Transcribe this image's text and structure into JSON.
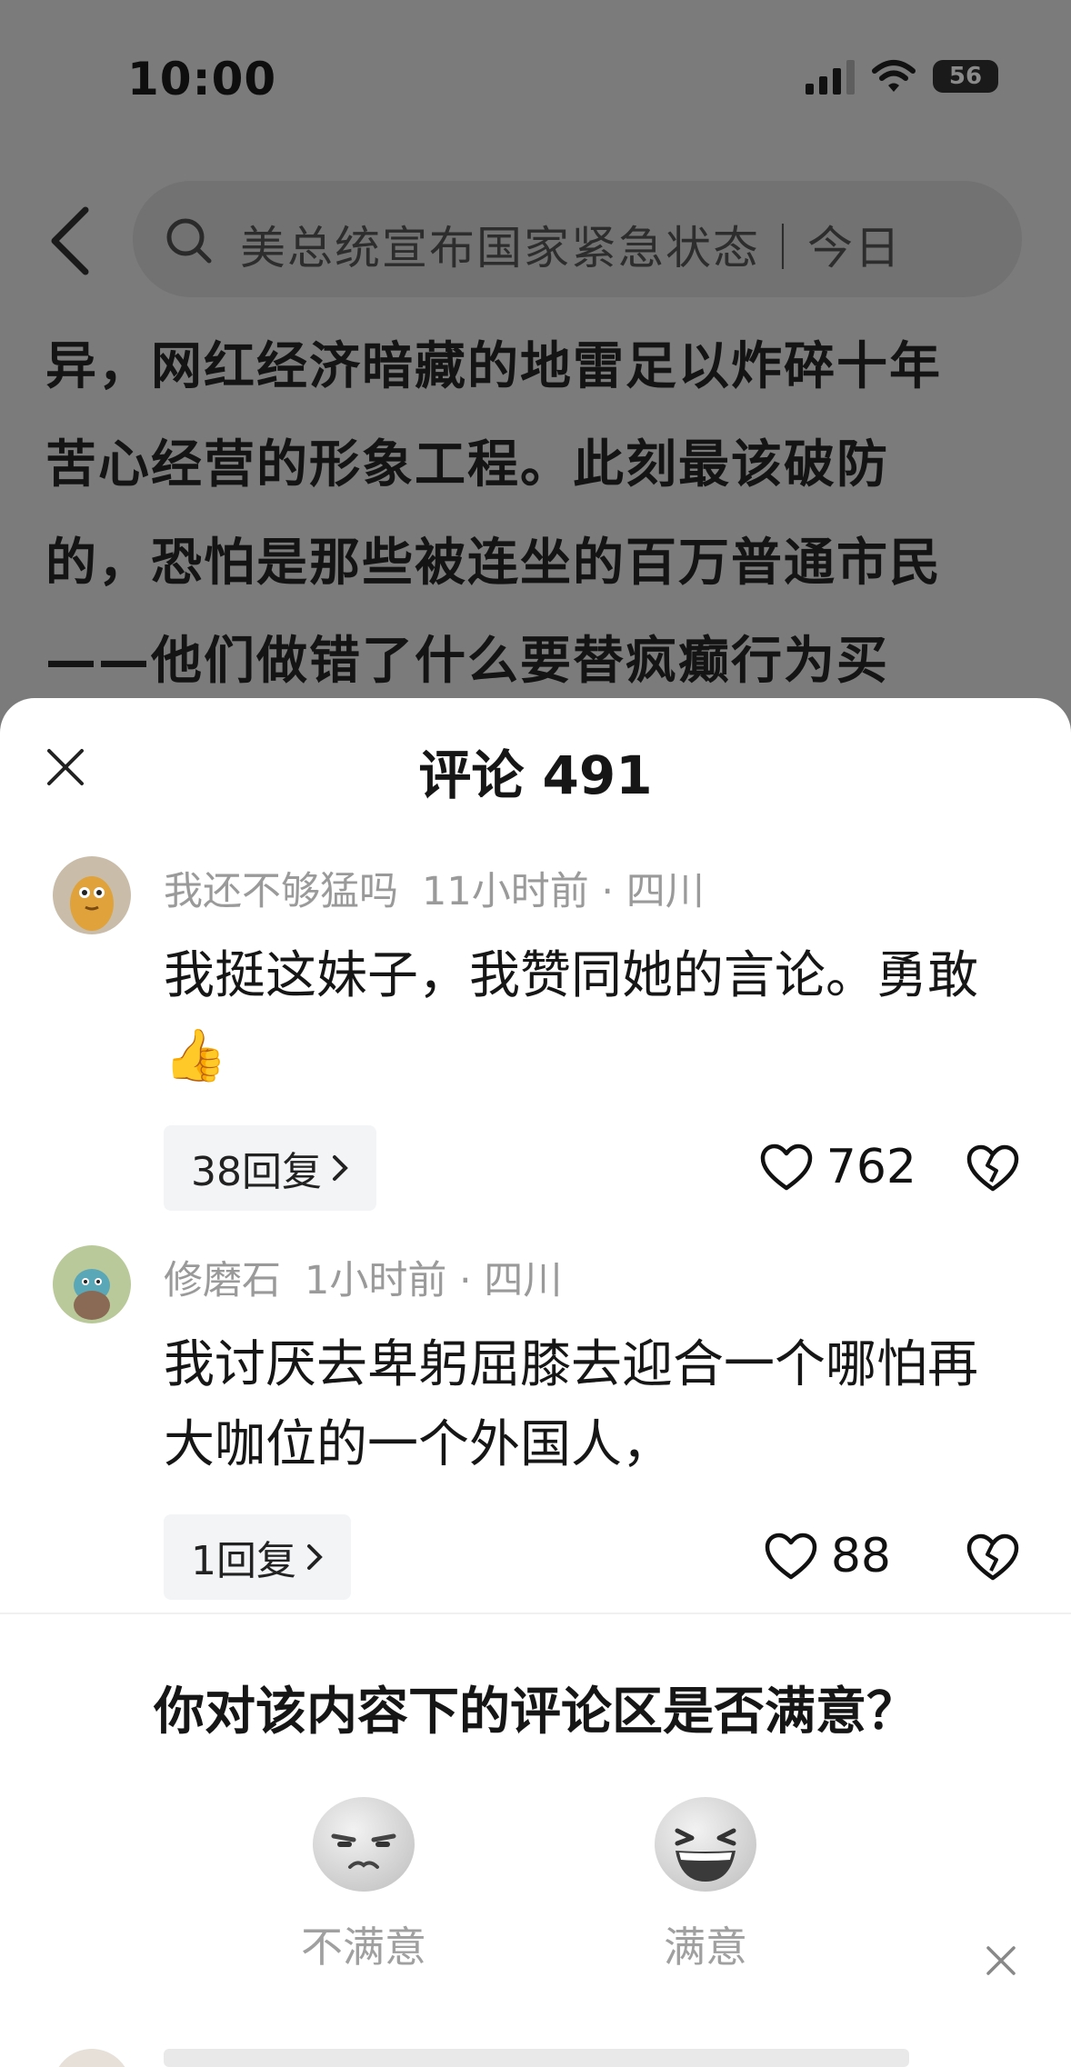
{
  "status_bar": {
    "time": "10:00",
    "battery": "56"
  },
  "search": {
    "text": "美总统宣布国家紧急状态｜今日"
  },
  "article": {
    "lines": [
      "异，网红经济暗藏的地雷足以炸碎十年",
      "苦心经营的形象工程。此刻最该破防",
      "的，恐怕是那些被连坐的百万普通市民",
      "——他们做错了什么要替疯癫行为买"
    ]
  },
  "comments_panel": {
    "title": "评论 491",
    "comments": [
      {
        "author": "我还不够猛吗",
        "time": "11小时前",
        "location": "四川",
        "text": "我挺这妹子，我赞同她的言论。勇敢👍",
        "replies": "38回复",
        "likes": "762"
      },
      {
        "author": "修磨石",
        "time": "1小时前",
        "location": "四川",
        "text": "我讨厌去卑躬屈膝去迎合一个哪怕再大咖位的一个外国人，",
        "replies": "1回复",
        "likes": "88"
      }
    ]
  },
  "survey": {
    "question": "你对该内容下的评论区是否满意？",
    "options": [
      {
        "label": "不满意",
        "icon": "unamused-face-icon"
      },
      {
        "label": "满意",
        "icon": "laughing-face-icon"
      }
    ]
  }
}
